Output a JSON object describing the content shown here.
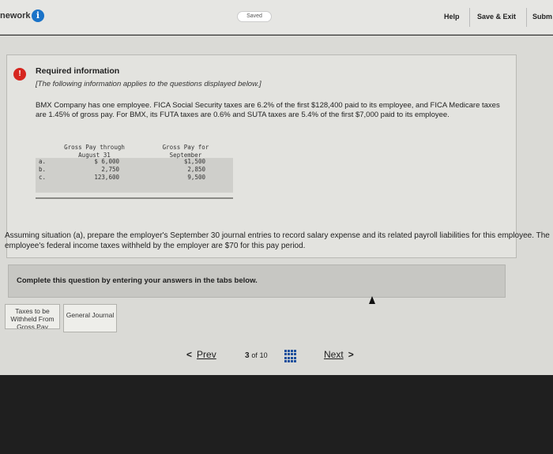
{
  "header": {
    "title": "nework",
    "saved": "Saved",
    "help": "Help",
    "save_exit": "Save & Exit",
    "submit": "Subm"
  },
  "required": {
    "alert": "!",
    "title": "Required information",
    "note": "[The following information applies to the questions displayed below.]",
    "text": "BMX Company has one employee. FICA Social Security taxes are 6.2% of the first $128,400 paid to its employee, and FICA Medicare taxes are 1.45% of gross pay. For BMX, its FUTA taxes are 0.6% and SUTA taxes are 5.4% of the first $7,000 paid to its employee."
  },
  "pay_table": {
    "header1": "Gross Pay through August 31",
    "header2": "Gross Pay for September",
    "rows": [
      {
        "label": "a.",
        "through_aug": "$  6,000",
        "september": "$1,500"
      },
      {
        "label": "b.",
        "through_aug": "2,750",
        "september": "2,850"
      },
      {
        "label": "c.",
        "through_aug": "123,600",
        "september": "9,500"
      }
    ]
  },
  "question": "Assuming situation (a), prepare the employer's September 30 journal entries to record salary expense and its related payroll liabilities for this employee. The employee's federal income taxes withheld by the employer are $70 for this pay period.",
  "complete": "Complete this question by entering your answers in the tabs below.",
  "tabs": [
    {
      "label": "Taxes to be Withheld From Gross Pay"
    },
    {
      "label": "General Journal"
    }
  ],
  "pager": {
    "prev": "Prev",
    "current": "3",
    "of": "of",
    "total": "10",
    "next": "Next"
  }
}
